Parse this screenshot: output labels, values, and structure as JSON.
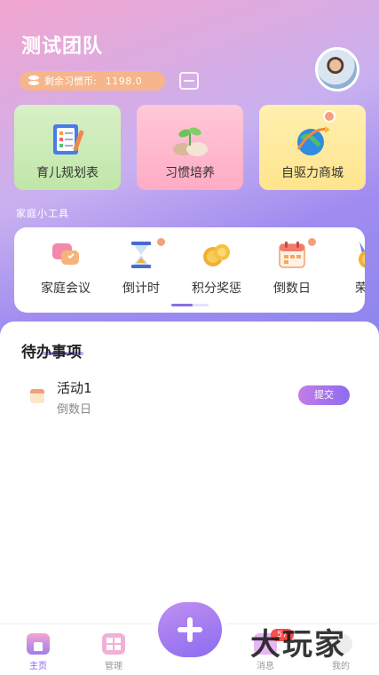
{
  "header": {
    "team_name": "测试团队",
    "coin_label": "剩余习惯币",
    "coin_separator": ":",
    "coin_value": "1198.0"
  },
  "cards": [
    {
      "label": "育儿规划表",
      "icon": "planner-clipboard-icon",
      "locked": false
    },
    {
      "label": "习惯培养",
      "icon": "sprout-seedling-icon",
      "locked": false
    },
    {
      "label": "自驱力商城",
      "icon": "globe-rocket-icon",
      "locked": true
    }
  ],
  "tools": {
    "section_label": "家庭小工具",
    "items": [
      {
        "label": "家庭会议",
        "icon": "meeting-chat-icon",
        "locked": false
      },
      {
        "label": "倒计时",
        "icon": "hourglass-icon",
        "locked": true
      },
      {
        "label": "积分奖惩",
        "icon": "coins-icon",
        "locked": false
      },
      {
        "label": "倒数日",
        "icon": "calendar-icon",
        "locked": true
      },
      {
        "label": "荣誉",
        "icon": "medal-icon",
        "locked": false
      }
    ]
  },
  "todo": {
    "title": "待办事项",
    "items": [
      {
        "name": "活动1",
        "type": "倒数日",
        "action": "提交"
      }
    ]
  },
  "tabbar": {
    "home": "主页",
    "manage": "管理",
    "messages": "消息",
    "messages_badge": "57",
    "mine": "我的"
  },
  "watermark": "大玩家",
  "colors": {
    "accent": "#8a5cf0",
    "coin_pill": "#f6b58a",
    "badge": "#ff4b4b"
  }
}
